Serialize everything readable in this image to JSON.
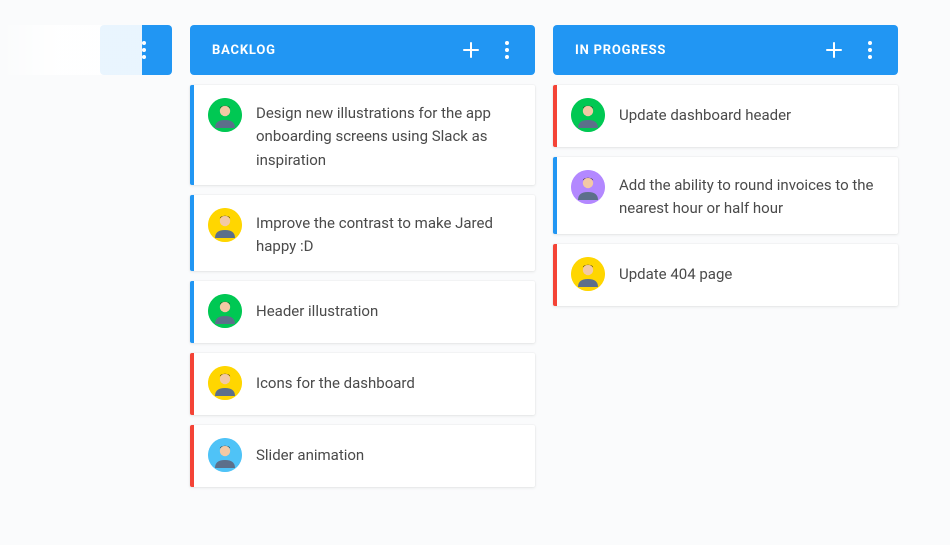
{
  "colors": {
    "header": "#2196f3",
    "accent_blue": "#2196f3",
    "accent_red": "#f44336"
  },
  "avatars": {
    "a1": {
      "bg": "#00c853"
    },
    "a2": {
      "bg": "#ffd600"
    },
    "a3": {
      "bg": "#b388ff"
    },
    "a4": {
      "bg": "#4fc3f7"
    }
  },
  "columns": [
    {
      "title": "BACKLOG",
      "cards": [
        {
          "accent": "blue",
          "avatar": "a1",
          "text": "Design new illustrations for the app onboarding screens using Slack as inspiration"
        },
        {
          "accent": "blue",
          "avatar": "a2",
          "text": "Improve the contrast to make Jared happy :D"
        },
        {
          "accent": "blue",
          "avatar": "a1",
          "text": "Header illustration"
        },
        {
          "accent": "red",
          "avatar": "a2",
          "text": "Icons for the dashboard"
        },
        {
          "accent": "red",
          "avatar": "a4",
          "text": "Slider animation"
        }
      ]
    },
    {
      "title": "IN PROGRESS",
      "cards": [
        {
          "accent": "red",
          "avatar": "a1",
          "text": "Update dashboard header"
        },
        {
          "accent": "blue",
          "avatar": "a3",
          "text": "Add the ability to round invoices to the nearest hour or half hour"
        },
        {
          "accent": "red",
          "avatar": "a2",
          "text": "Update 404 page"
        }
      ]
    }
  ]
}
